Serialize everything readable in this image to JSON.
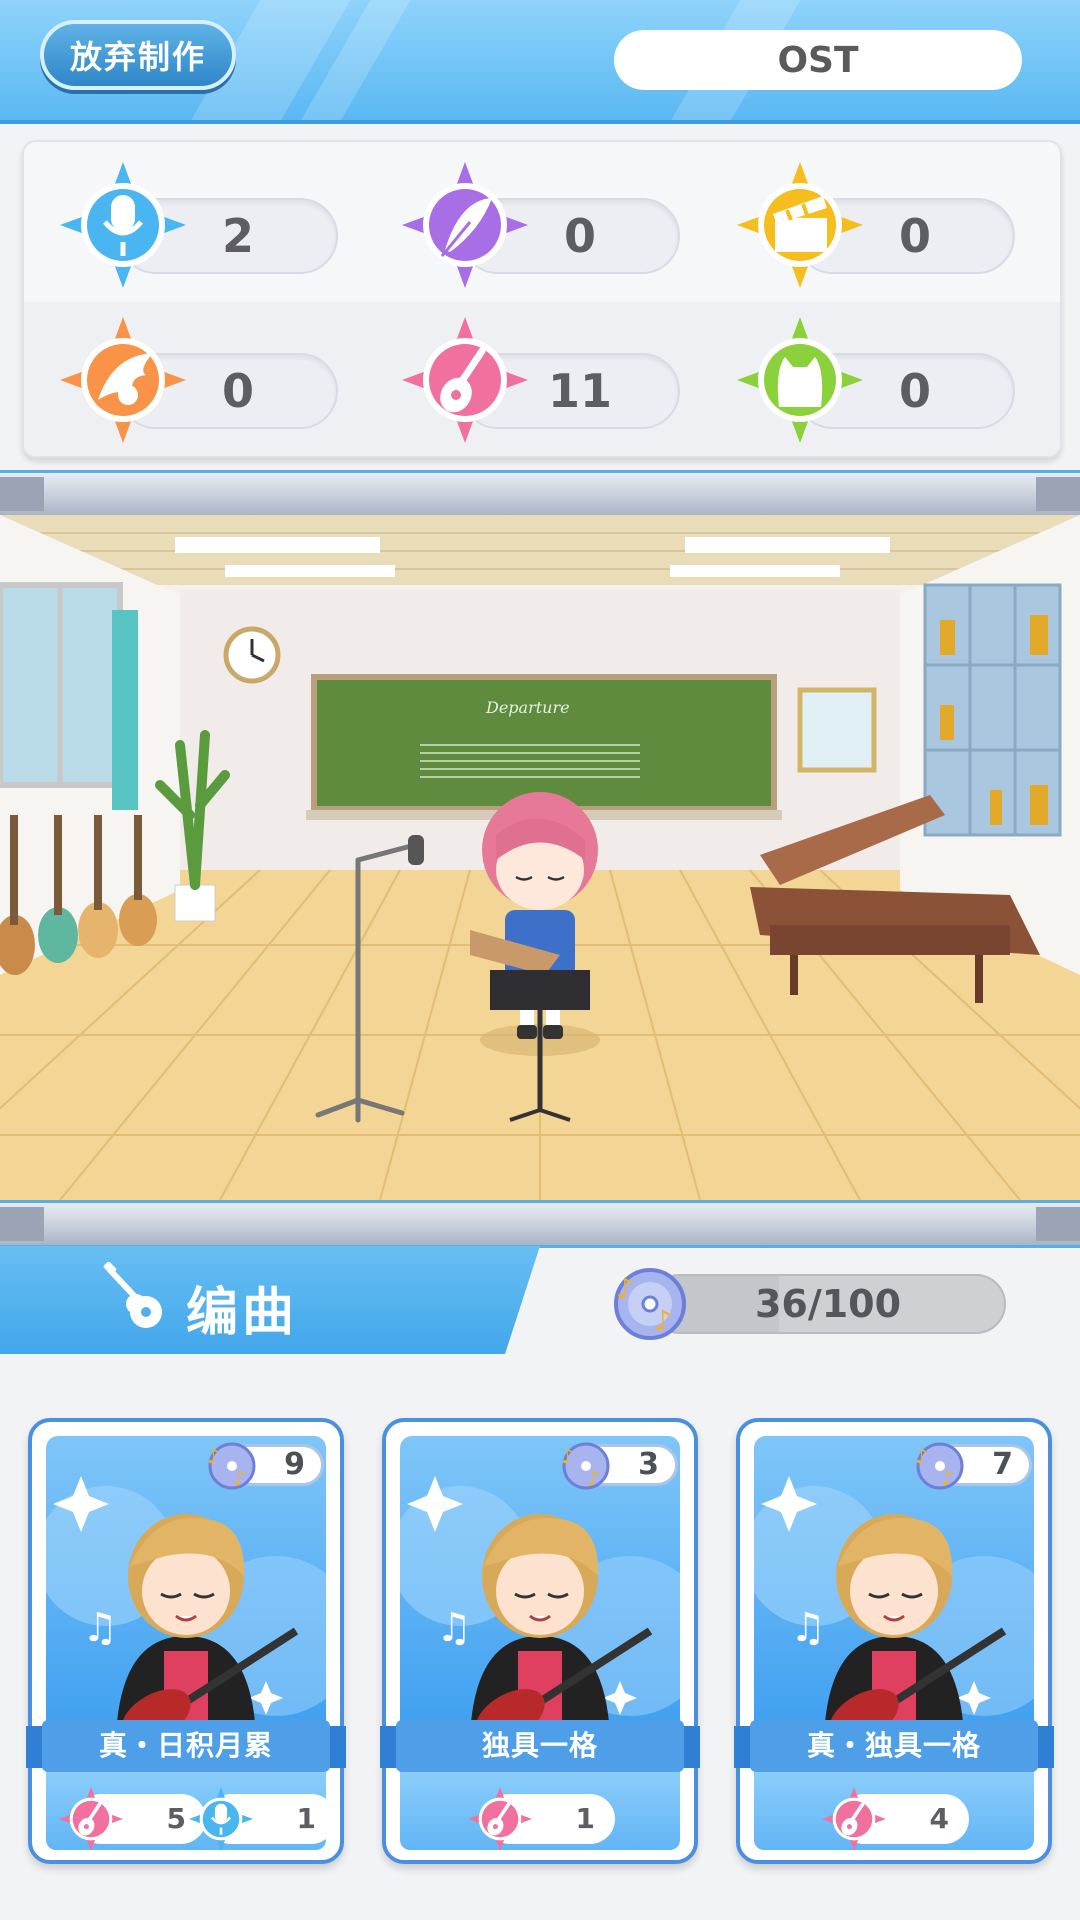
{
  "header": {
    "abandon_label": "放弃制作",
    "song_title": "OST"
  },
  "stats": [
    {
      "name": "vocal",
      "icon": "microphone-icon",
      "color": "#49b6f2",
      "value": "2"
    },
    {
      "name": "lyrics",
      "icon": "quill-icon",
      "color": "#a86ee6",
      "value": "0"
    },
    {
      "name": "production",
      "icon": "clapperboard-icon",
      "color": "#f5bd1d",
      "value": "0"
    },
    {
      "name": "performance",
      "icon": "phoenix-icon",
      "color": "#f89348",
      "value": "0"
    },
    {
      "name": "guitar",
      "icon": "guitar-icon",
      "color": "#f0719d",
      "value": "11"
    },
    {
      "name": "style",
      "icon": "cat-icon",
      "color": "#8bd13c",
      "value": "0"
    }
  ],
  "compose": {
    "label": "编曲",
    "progress_text": "36/100",
    "progress_current": 36,
    "progress_max": 100
  },
  "cards": [
    {
      "title": "真・日积月累",
      "count": "9",
      "skills": [
        {
          "icon": "guitar-icon",
          "color": "#f0719d",
          "value": "5"
        },
        {
          "icon": "microphone-icon",
          "color": "#49b6f2",
          "value": "1"
        }
      ]
    },
    {
      "title": "独具一格",
      "count": "3",
      "skills": [
        {
          "icon": "guitar-icon",
          "color": "#f0719d",
          "value": "1"
        }
      ]
    },
    {
      "title": "真・独具一格",
      "count": "7",
      "skills": [
        {
          "icon": "guitar-icon",
          "color": "#f0719d",
          "value": "4"
        }
      ]
    }
  ],
  "scene": {
    "blackboard_title": "Departure"
  }
}
